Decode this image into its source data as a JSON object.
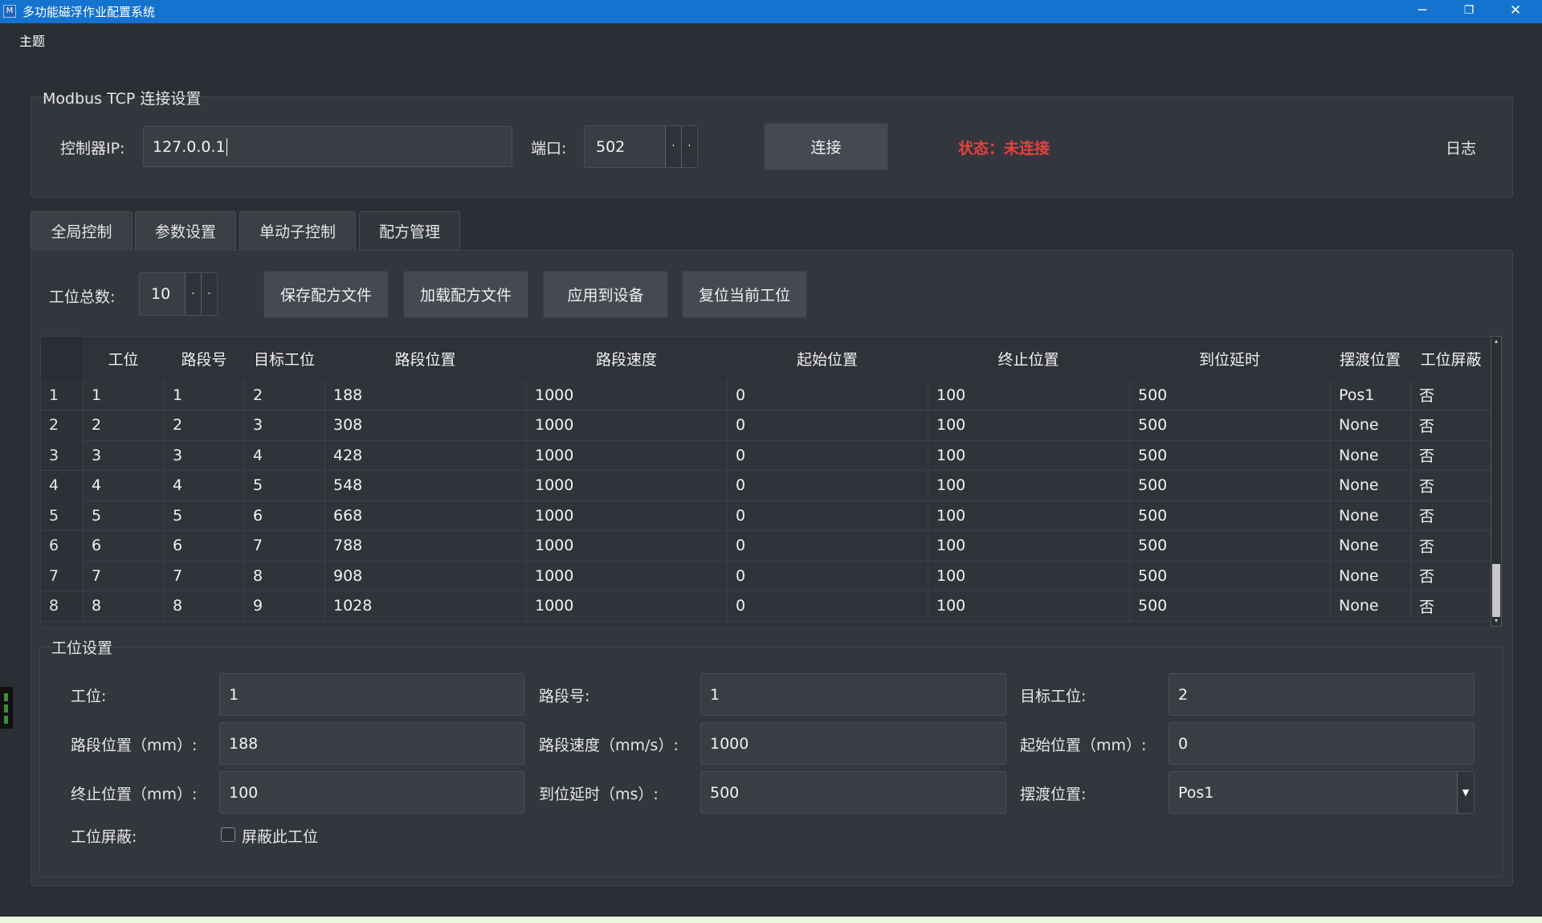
{
  "window": {
    "title": "多功能磁浮作业配置系统",
    "icon": "app-logo-icon",
    "controls": {
      "minimize": "─",
      "restore": "❐",
      "close": "✕"
    }
  },
  "menu": {
    "items": [
      {
        "label": "主题"
      }
    ]
  },
  "connection": {
    "group_title": "Modbus TCP 连接设置",
    "ip_label": "控制器IP:",
    "ip_value": "127.0.0.1",
    "port_label": "端口:",
    "port_value": "502",
    "connect_label": "连接",
    "status_text": "状态：未连接",
    "status_color": "#e8413c",
    "log_label": "日志"
  },
  "tabs": [
    {
      "label": "全局控制"
    },
    {
      "label": "参数设置"
    },
    {
      "label": "单动子控制"
    },
    {
      "label": "配方管理",
      "active": true
    }
  ],
  "recipe": {
    "total_label": "工位总数:",
    "total_value": "10",
    "save_label": "保存配方文件",
    "load_label": "加载配方文件",
    "apply_label": "应用到设备",
    "reset_label": "复位当前工位"
  },
  "table": {
    "headers": [
      "工位",
      "路段号",
      "目标工位",
      "路段位置",
      "路段速度",
      "起始位置",
      "终止位置",
      "到位延时",
      "摆渡位置",
      "工位屏蔽"
    ],
    "rows": [
      [
        "1",
        "1",
        "1",
        "2",
        "188",
        "1000",
        "0",
        "100",
        "500",
        "Pos1",
        "否"
      ],
      [
        "2",
        "2",
        "2",
        "3",
        "308",
        "1000",
        "0",
        "100",
        "500",
        "None",
        "否"
      ],
      [
        "3",
        "3",
        "3",
        "4",
        "428",
        "1000",
        "0",
        "100",
        "500",
        "None",
        "否"
      ],
      [
        "4",
        "4",
        "4",
        "5",
        "548",
        "1000",
        "0",
        "100",
        "500",
        "None",
        "否"
      ],
      [
        "5",
        "5",
        "5",
        "6",
        "668",
        "1000",
        "0",
        "100",
        "500",
        "None",
        "否"
      ],
      [
        "6",
        "6",
        "6",
        "7",
        "788",
        "1000",
        "0",
        "100",
        "500",
        "None",
        "否"
      ],
      [
        "7",
        "7",
        "7",
        "8",
        "908",
        "1000",
        "0",
        "100",
        "500",
        "None",
        "否"
      ],
      [
        "8",
        "8",
        "8",
        "9",
        "1028",
        "1000",
        "0",
        "100",
        "500",
        "None",
        "否"
      ]
    ]
  },
  "station": {
    "group_title": "工位设置",
    "station_label": "工位:",
    "station_value": "1",
    "segment_label": "路段号:",
    "segment_value": "1",
    "target_label": "目标工位:",
    "target_value": "2",
    "seg_pos_label": "路段位置（mm）:",
    "seg_pos_value": "188",
    "seg_speed_label": "路段速度（mm/s）:",
    "seg_speed_value": "1000",
    "start_pos_label": "起始位置（mm）:",
    "start_pos_value": "0",
    "end_pos_label": "终止位置（mm）:",
    "end_pos_value": "100",
    "delay_label": "到位延时（ms）:",
    "delay_value": "500",
    "ferry_label": "摆渡位置:",
    "ferry_value": "Pos1",
    "mask_label": "工位屏蔽:",
    "mask_checkbox_label": "屏蔽此工位",
    "mask_checked": false
  }
}
